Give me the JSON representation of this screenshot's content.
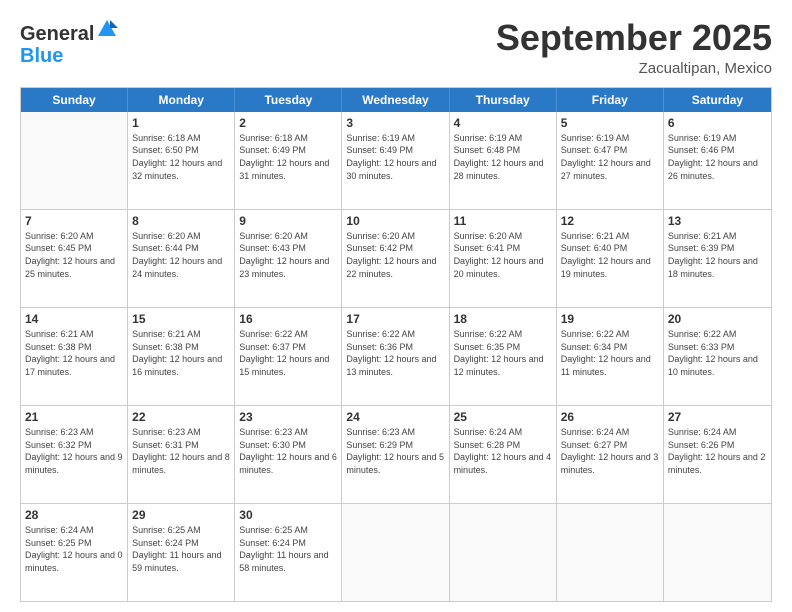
{
  "logo": {
    "general": "General",
    "blue": "Blue"
  },
  "header": {
    "month": "September 2025",
    "location": "Zacualtipan, Mexico"
  },
  "weekdays": [
    "Sunday",
    "Monday",
    "Tuesday",
    "Wednesday",
    "Thursday",
    "Friday",
    "Saturday"
  ],
  "weeks": [
    [
      {
        "day": "",
        "empty": true
      },
      {
        "day": "1",
        "sunrise": "Sunrise: 6:18 AM",
        "sunset": "Sunset: 6:50 PM",
        "daylight": "Daylight: 12 hours and 32 minutes."
      },
      {
        "day": "2",
        "sunrise": "Sunrise: 6:18 AM",
        "sunset": "Sunset: 6:49 PM",
        "daylight": "Daylight: 12 hours and 31 minutes."
      },
      {
        "day": "3",
        "sunrise": "Sunrise: 6:19 AM",
        "sunset": "Sunset: 6:49 PM",
        "daylight": "Daylight: 12 hours and 30 minutes."
      },
      {
        "day": "4",
        "sunrise": "Sunrise: 6:19 AM",
        "sunset": "Sunset: 6:48 PM",
        "daylight": "Daylight: 12 hours and 28 minutes."
      },
      {
        "day": "5",
        "sunrise": "Sunrise: 6:19 AM",
        "sunset": "Sunset: 6:47 PM",
        "daylight": "Daylight: 12 hours and 27 minutes."
      },
      {
        "day": "6",
        "sunrise": "Sunrise: 6:19 AM",
        "sunset": "Sunset: 6:46 PM",
        "daylight": "Daylight: 12 hours and 26 minutes."
      }
    ],
    [
      {
        "day": "7",
        "sunrise": "Sunrise: 6:20 AM",
        "sunset": "Sunset: 6:45 PM",
        "daylight": "Daylight: 12 hours and 25 minutes."
      },
      {
        "day": "8",
        "sunrise": "Sunrise: 6:20 AM",
        "sunset": "Sunset: 6:44 PM",
        "daylight": "Daylight: 12 hours and 24 minutes."
      },
      {
        "day": "9",
        "sunrise": "Sunrise: 6:20 AM",
        "sunset": "Sunset: 6:43 PM",
        "daylight": "Daylight: 12 hours and 23 minutes."
      },
      {
        "day": "10",
        "sunrise": "Sunrise: 6:20 AM",
        "sunset": "Sunset: 6:42 PM",
        "daylight": "Daylight: 12 hours and 22 minutes."
      },
      {
        "day": "11",
        "sunrise": "Sunrise: 6:20 AM",
        "sunset": "Sunset: 6:41 PM",
        "daylight": "Daylight: 12 hours and 20 minutes."
      },
      {
        "day": "12",
        "sunrise": "Sunrise: 6:21 AM",
        "sunset": "Sunset: 6:40 PM",
        "daylight": "Daylight: 12 hours and 19 minutes."
      },
      {
        "day": "13",
        "sunrise": "Sunrise: 6:21 AM",
        "sunset": "Sunset: 6:39 PM",
        "daylight": "Daylight: 12 hours and 18 minutes."
      }
    ],
    [
      {
        "day": "14",
        "sunrise": "Sunrise: 6:21 AM",
        "sunset": "Sunset: 6:38 PM",
        "daylight": "Daylight: 12 hours and 17 minutes."
      },
      {
        "day": "15",
        "sunrise": "Sunrise: 6:21 AM",
        "sunset": "Sunset: 6:38 PM",
        "daylight": "Daylight: 12 hours and 16 minutes."
      },
      {
        "day": "16",
        "sunrise": "Sunrise: 6:22 AM",
        "sunset": "Sunset: 6:37 PM",
        "daylight": "Daylight: 12 hours and 15 minutes."
      },
      {
        "day": "17",
        "sunrise": "Sunrise: 6:22 AM",
        "sunset": "Sunset: 6:36 PM",
        "daylight": "Daylight: 12 hours and 13 minutes."
      },
      {
        "day": "18",
        "sunrise": "Sunrise: 6:22 AM",
        "sunset": "Sunset: 6:35 PM",
        "daylight": "Daylight: 12 hours and 12 minutes."
      },
      {
        "day": "19",
        "sunrise": "Sunrise: 6:22 AM",
        "sunset": "Sunset: 6:34 PM",
        "daylight": "Daylight: 12 hours and 11 minutes."
      },
      {
        "day": "20",
        "sunrise": "Sunrise: 6:22 AM",
        "sunset": "Sunset: 6:33 PM",
        "daylight": "Daylight: 12 hours and 10 minutes."
      }
    ],
    [
      {
        "day": "21",
        "sunrise": "Sunrise: 6:23 AM",
        "sunset": "Sunset: 6:32 PM",
        "daylight": "Daylight: 12 hours and 9 minutes."
      },
      {
        "day": "22",
        "sunrise": "Sunrise: 6:23 AM",
        "sunset": "Sunset: 6:31 PM",
        "daylight": "Daylight: 12 hours and 8 minutes."
      },
      {
        "day": "23",
        "sunrise": "Sunrise: 6:23 AM",
        "sunset": "Sunset: 6:30 PM",
        "daylight": "Daylight: 12 hours and 6 minutes."
      },
      {
        "day": "24",
        "sunrise": "Sunrise: 6:23 AM",
        "sunset": "Sunset: 6:29 PM",
        "daylight": "Daylight: 12 hours and 5 minutes."
      },
      {
        "day": "25",
        "sunrise": "Sunrise: 6:24 AM",
        "sunset": "Sunset: 6:28 PM",
        "daylight": "Daylight: 12 hours and 4 minutes."
      },
      {
        "day": "26",
        "sunrise": "Sunrise: 6:24 AM",
        "sunset": "Sunset: 6:27 PM",
        "daylight": "Daylight: 12 hours and 3 minutes."
      },
      {
        "day": "27",
        "sunrise": "Sunrise: 6:24 AM",
        "sunset": "Sunset: 6:26 PM",
        "daylight": "Daylight: 12 hours and 2 minutes."
      }
    ],
    [
      {
        "day": "28",
        "sunrise": "Sunrise: 6:24 AM",
        "sunset": "Sunset: 6:25 PM",
        "daylight": "Daylight: 12 hours and 0 minutes."
      },
      {
        "day": "29",
        "sunrise": "Sunrise: 6:25 AM",
        "sunset": "Sunset: 6:24 PM",
        "daylight": "Daylight: 11 hours and 59 minutes."
      },
      {
        "day": "30",
        "sunrise": "Sunrise: 6:25 AM",
        "sunset": "Sunset: 6:24 PM",
        "daylight": "Daylight: 11 hours and 58 minutes."
      },
      {
        "day": "",
        "empty": true
      },
      {
        "day": "",
        "empty": true
      },
      {
        "day": "",
        "empty": true
      },
      {
        "day": "",
        "empty": true
      }
    ]
  ]
}
